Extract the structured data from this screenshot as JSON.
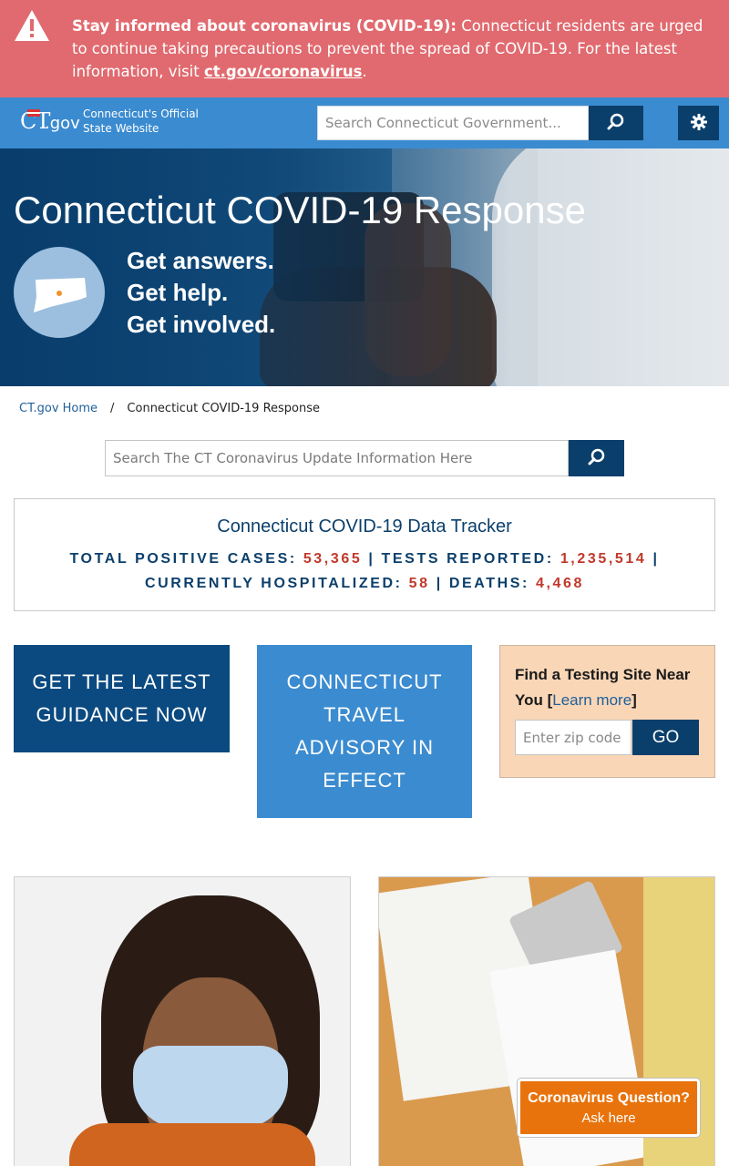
{
  "alert": {
    "title": "Stay informed about coronavirus (COVID-19):",
    "body": " Connecticut residents are urged to continue taking precautions to prevent the spread of COVID-19. For the latest information, visit ",
    "link": "ct.gov/coronavirus",
    "end": "."
  },
  "header": {
    "logo_ct": "CT",
    "logo_gov": ".gov",
    "tagline_line1": "Connecticut's Official",
    "tagline_line2": "State Website",
    "search_placeholder": "Search Connecticut Government...",
    "icons": {
      "search": "search-icon",
      "settings": "gear-icon"
    }
  },
  "hero": {
    "title": "Connecticut COVID-19 Response",
    "lines": [
      "Get answers.",
      "Get help.",
      "Get involved."
    ]
  },
  "breadcrumb": {
    "home": "CT.gov Home",
    "separator": "/",
    "current": "Connecticut COVID-19 Response"
  },
  "main_search": {
    "placeholder": "Search The CT Coronavirus Update Information Here"
  },
  "tracker": {
    "title": "Connecticut COVID-19 Data Tracker",
    "stats": [
      {
        "label": "TOTAL POSITIVE CASES:",
        "value": "53,365"
      },
      {
        "label": "TESTS REPORTED:",
        "value": "1,235,514"
      },
      {
        "label": "CURRENTLY HOSPITALIZED:",
        "value": "58"
      },
      {
        "label": "DEATHS:",
        "value": "4,468"
      }
    ],
    "divider": "|"
  },
  "tiles": {
    "guidance": "GET THE LATEST GUIDANCE NOW",
    "travel": "CONNECTICUT TRAVEL ADVISORY IN EFFECT"
  },
  "testing": {
    "text": "Find a Testing Site Near You [",
    "link": "Learn more",
    "end": "]",
    "zip_placeholder": "Enter zip code",
    "go_label": "GO"
  },
  "chat": {
    "title": "Coronavirus Question?",
    "subtitle": "Ask here"
  },
  "colors": {
    "alert_bg": "#e06a6f",
    "header_bg": "#3b8bd0",
    "navy": "#0b3f6b",
    "value_red": "#c0392b",
    "chat_orange": "#e8730c",
    "testing_bg": "#f9d6b6"
  }
}
